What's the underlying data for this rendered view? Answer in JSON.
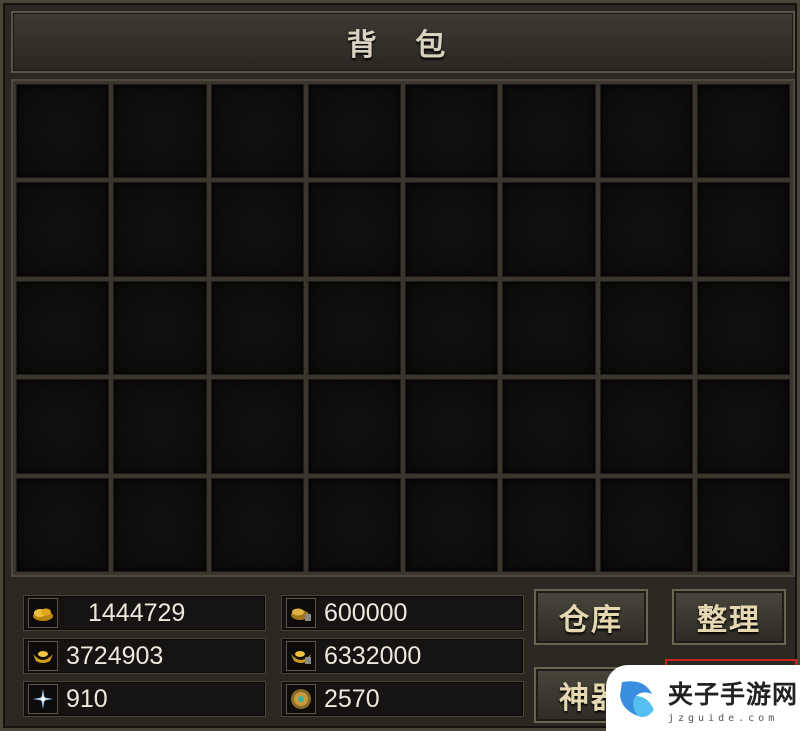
{
  "window": {
    "title": "背 包"
  },
  "inventory": {
    "rows": 5,
    "cols": 8
  },
  "resources": [
    {
      "icon": "gold-ingot-pile-icon",
      "value": "1444729"
    },
    {
      "icon": "bound-gold-pile-icon",
      "value": "600000"
    },
    {
      "icon": "yuanbao-ingot-icon",
      "value": "3724903"
    },
    {
      "icon": "bound-yuanbao-icon",
      "value": "6332000"
    },
    {
      "icon": "star-spark-icon",
      "value": "910"
    },
    {
      "icon": "round-token-icon",
      "value": "2570"
    }
  ],
  "buttons": {
    "warehouse": "仓库",
    "sort": "整理",
    "artifact": "神器"
  },
  "watermark": {
    "title": "夹子手游网",
    "subtitle": "jzguide.com"
  },
  "colors": {
    "highlight": "#c8231e",
    "button_text": "#e6d9b2"
  }
}
